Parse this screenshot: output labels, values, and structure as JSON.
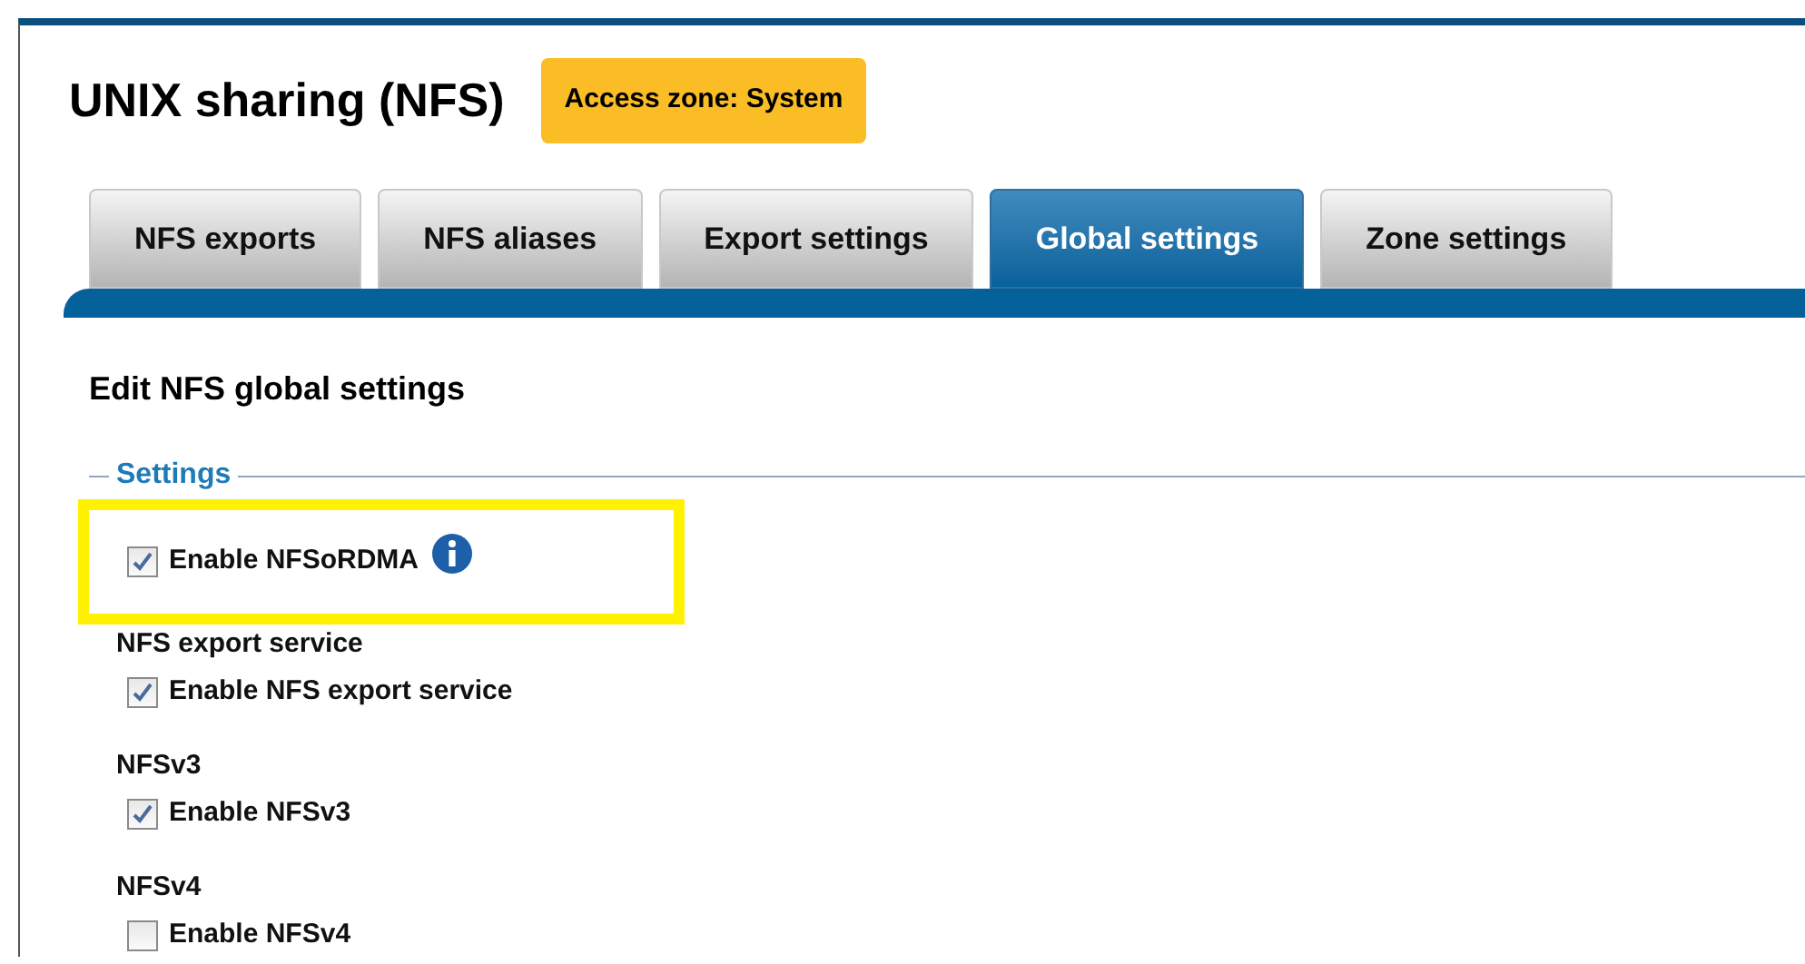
{
  "page": {
    "title": "UNIX sharing (NFS)",
    "zone_badge": "Access zone: System"
  },
  "tabs": [
    {
      "label": "NFS exports",
      "selected": false
    },
    {
      "label": "NFS aliases",
      "selected": false
    },
    {
      "label": "Export settings",
      "selected": false
    },
    {
      "label": "Global settings",
      "selected": true
    },
    {
      "label": "Zone settings",
      "selected": false
    }
  ],
  "form": {
    "heading": "Edit NFS global settings",
    "legend": "Settings",
    "items": [
      {
        "kind": "checkbox",
        "label": "Enable NFSoRDMA",
        "checked": true,
        "highlighted": true,
        "info": true
      },
      {
        "kind": "heading",
        "label": "NFS export service"
      },
      {
        "kind": "checkbox",
        "label": "Enable NFS export service",
        "checked": true,
        "highlighted": false,
        "info": false
      },
      {
        "kind": "heading",
        "label": "NFSv3"
      },
      {
        "kind": "checkbox",
        "label": "Enable NFSv3",
        "checked": true,
        "highlighted": false,
        "info": false
      },
      {
        "kind": "heading",
        "label": "NFSv4"
      },
      {
        "kind": "checkbox",
        "label": "Enable NFSv4",
        "checked": false,
        "highlighted": false,
        "info": false
      }
    ]
  }
}
